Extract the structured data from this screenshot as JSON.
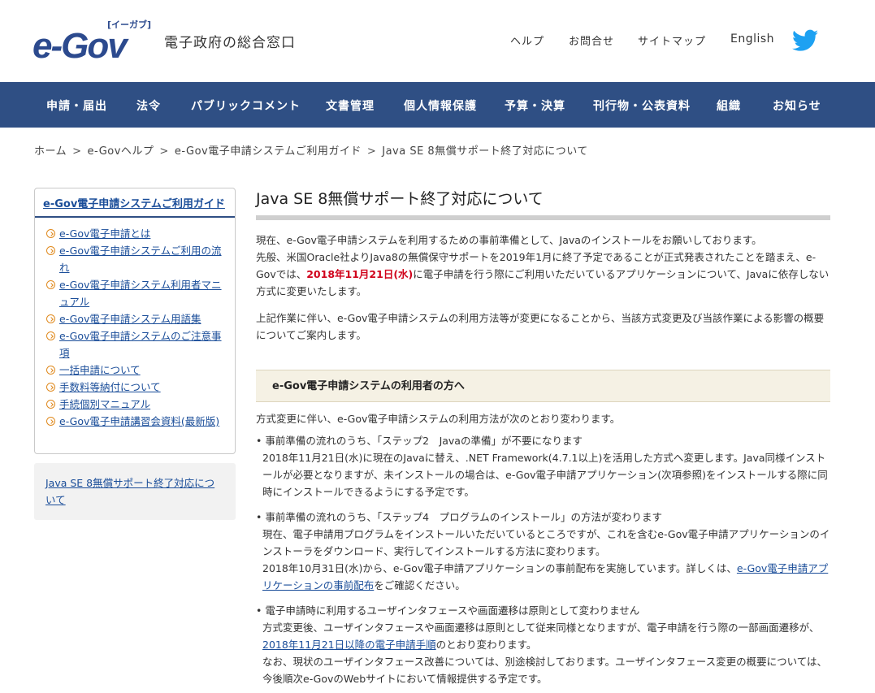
{
  "header": {
    "logo_text": "e-Gov",
    "logo_kana": "[イーガブ]",
    "site_subtitle": "電子政府の総合窓口",
    "links": {
      "help": "ヘルプ",
      "contact": "お問合せ",
      "sitemap": "サイトマップ",
      "english": "English"
    },
    "twitter_icon": "twitter-icon",
    "brand_color": "#2f4f84"
  },
  "gnav": {
    "items": [
      "申請・届出",
      "法令",
      "パブリックコメント",
      "文書管理",
      "個人情報保護",
      "予算・決算",
      "刊行物・公表資料",
      "組織",
      "お知らせ"
    ]
  },
  "breadcrumb": {
    "items": [
      "ホーム",
      "e-Govヘルプ",
      "e-Gov電子申請システムご利用ガイド",
      "Java SE 8無償サポート終了対応について"
    ],
    "separator": ">"
  },
  "sidebar": {
    "title": "e-Gov電子申請システムご利用ガイド",
    "items": [
      "e-Gov電子申請とは",
      "e-Gov電子申請システムご利用の流れ",
      "e-Gov電子申請システム利用者マニュアル",
      "e-Gov電子申請システム用語集",
      "e-Gov電子申請システムのご注意事項",
      "一括申請について",
      "手数料等納付について",
      "手続個別マニュアル",
      "e-Gov電子申請講習会資料(最新版)"
    ],
    "current": "Java SE 8無償サポート終了対応について"
  },
  "main": {
    "title": "Java SE 8無償サポート終了対応について",
    "p1_a": "現在、e-Gov電子申請システムを利用するための事前準備として、Javaのインストールをお願いしております。",
    "p1_b": "先般、米国Oracle社よりJava8の無償保守サポートを2019年1月に終了予定であることが正式発表されたことを踏まえ、e-Govでは、",
    "p1_date": "2018年11月21日(水)",
    "p1_c": "に電子申請を行う際にご利用いただいているアプリケーションについて、Javaに依存しない方式に変更いたします。",
    "p2": "上記作業に伴い、e-Gov電子申請システムの利用方法等が変更になることから、当該方式変更及び当該作業による影響の概要についてご案内します。",
    "section_head": "e-Gov電子申請システムの利用者の方へ",
    "section_intro": "方式変更に伴い、e-Gov電子申請システムの利用方法が次のとおり変わります。",
    "item1_lead": "事前準備の流れのうち、「ステップ2　Javaの準備」が不要になります",
    "item1_body": "2018年11月21日(水)に現在のJavaに替え、.NET Framework(4.7.1以上)を活用した方式へ変更します。Java同様インストールが必要となりますが、未インストールの場合は、e-Gov電子申請アプリケーション(次項参照)をインストールする際に同時にインストールできるようにする予定です。",
    "item2_lead": "事前準備の流れのうち、「ステップ4　プログラムのインストール」の方法が変わります",
    "item2_body1": "現在、電子申請用プログラムをインストールいただいているところですが、これを含むe-Gov電子申請アプリケーションのインストーラをダウンロード、実行してインストールする方法に変わります。",
    "item2_body2_a": "2018年10月31日(水)から、e-Gov電子申請アプリケーションの事前配布を実施しています。詳しくは、",
    "item2_body2_link": "e-Gov電子申請アプリケーションの事前配布",
    "item2_body2_b": "をご確認ください。",
    "item3_lead": "電子申請時に利用するユーザインタフェースや画面遷移は原則として変わりません",
    "item3_body1_a": "方式変更後、ユーザインタフェースや画面遷移は原則として従来同様となりますが、電子申請を行う際の一部画面遷移が、",
    "item3_body1_link": "2018年11月21日以降の電子申請手順",
    "item3_body1_b": "のとおり変わります。",
    "item3_body2": "なお、現状のユーザインタフェース改善については、別途検討しております。ユーザインタフェース変更の概要については、今後順次e-GovのWebサイトにおいて情報提供する予定です。"
  }
}
